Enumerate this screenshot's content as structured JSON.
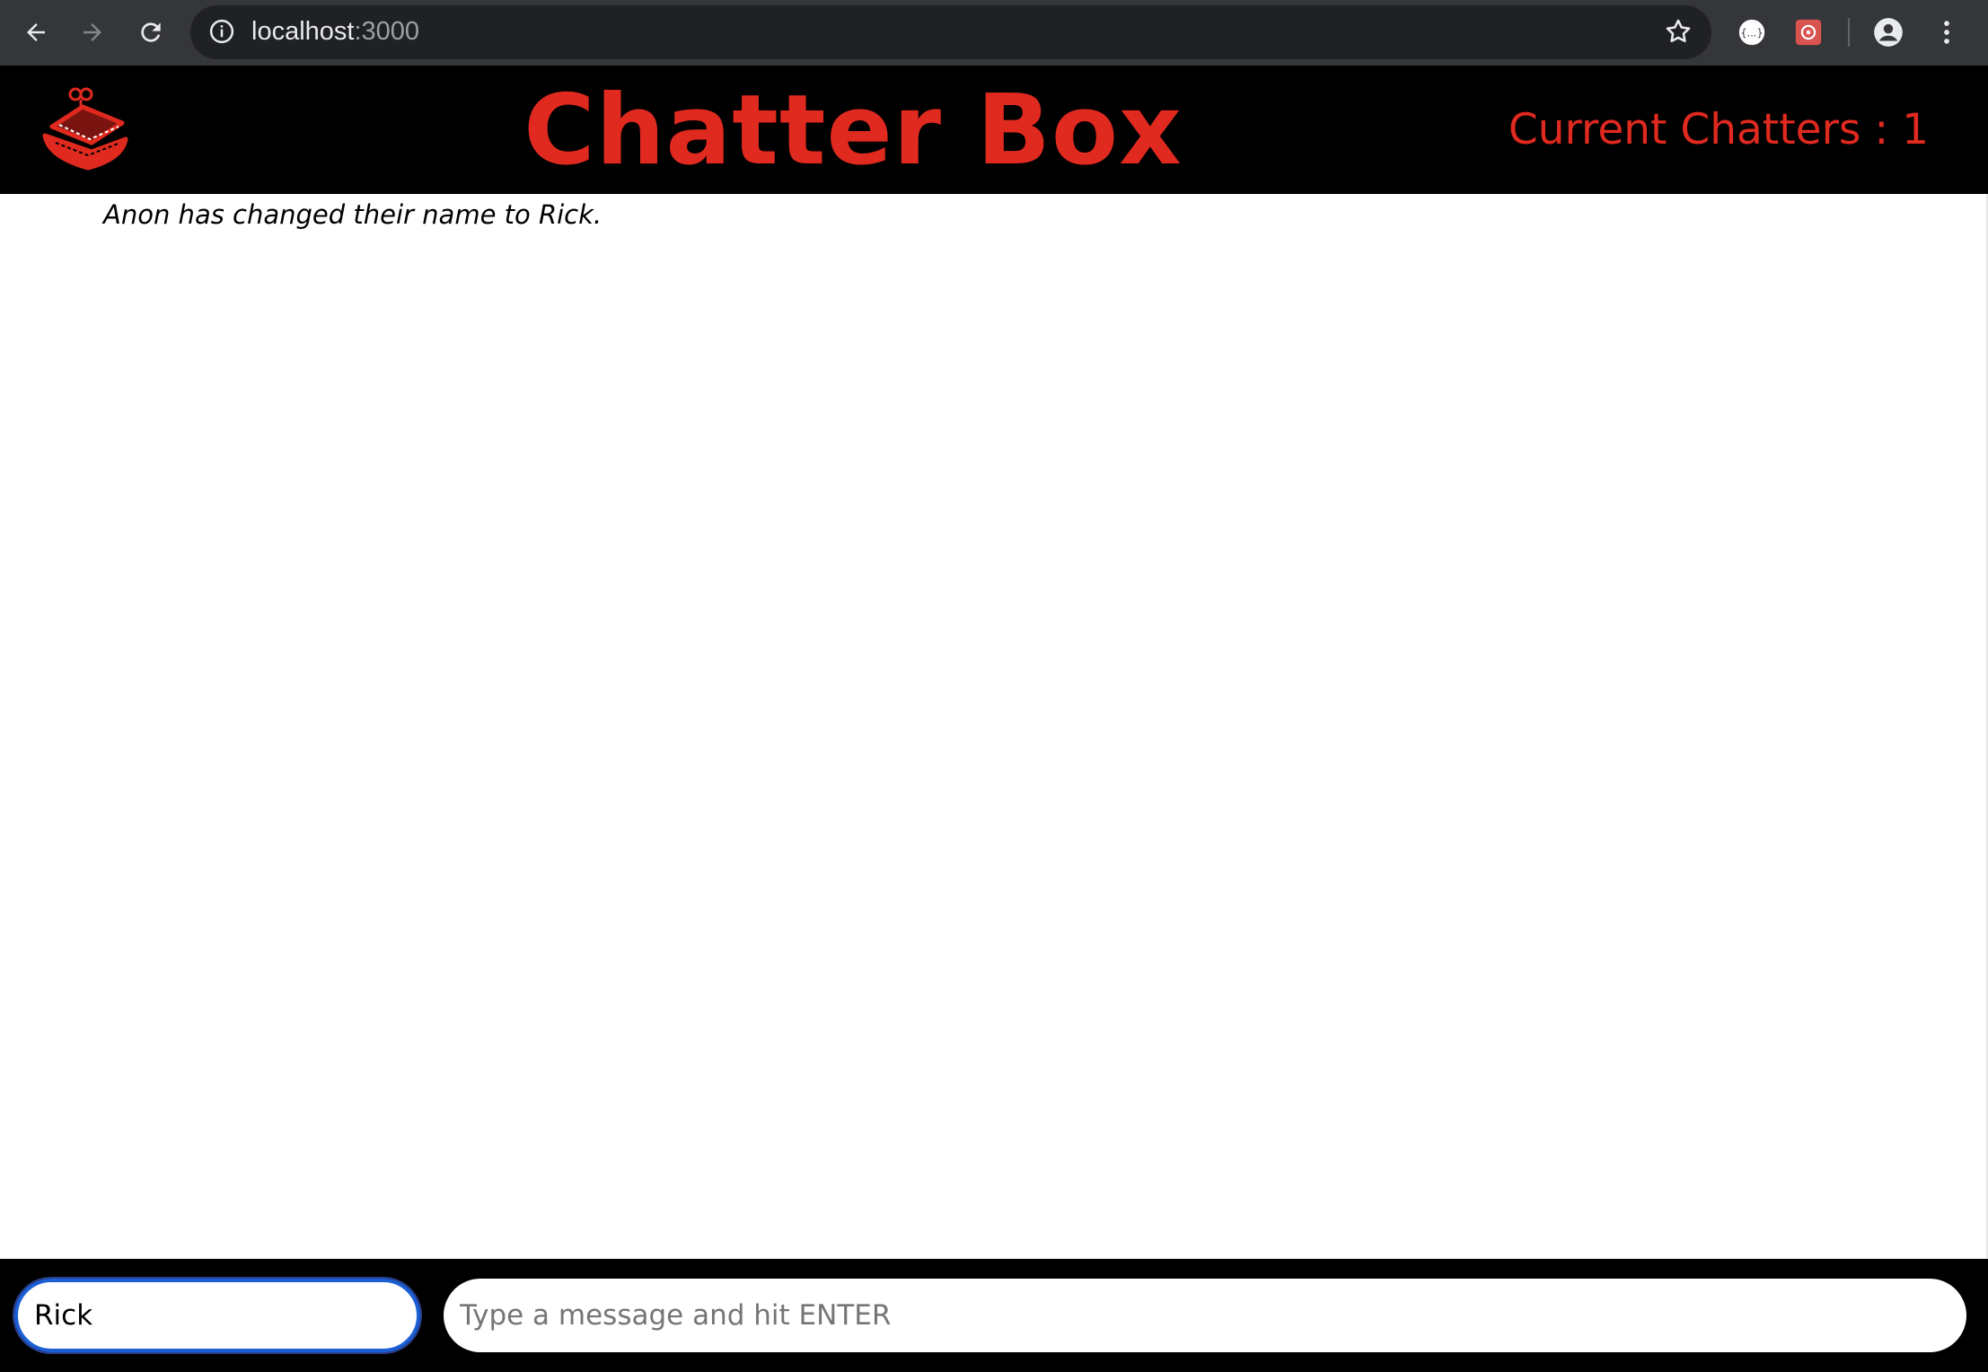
{
  "browser": {
    "url_host": "localhost",
    "url_port": ":3000",
    "icons": [
      "back-arrow-icon",
      "forward-arrow-icon",
      "reload-icon",
      "info-icon",
      "star-icon",
      "extension-icon",
      "extension-icon",
      "profile-icon",
      "menu-dots-icon"
    ]
  },
  "header": {
    "title": "Chatter Box",
    "chatters_label": "Current Chatters : 1",
    "logo_icon": "chattering-teeth-logo-icon"
  },
  "messages": [
    {
      "text": "Anon has changed their name to Rick."
    }
  ],
  "footer": {
    "name_value": "Rick",
    "message_placeholder": "Type a message and hit ENTER"
  },
  "colors": {
    "accent": "#e0291f",
    "header_bg": "#000000",
    "browser_bg": "#35363a"
  }
}
